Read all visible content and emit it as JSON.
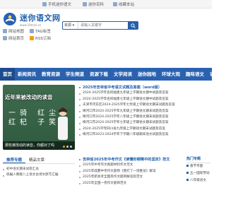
{
  "topbar": {
    "add_to_desktop": "手机迷你语文",
    "bookmark": "设为首页",
    "mobile": "迷你百科",
    "contact": "收藏本站"
  },
  "header": {
    "logo_title": "迷你语文网",
    "logo_sub": "www.19mini.cn",
    "links_row1": [
      "网站地图",
      "TAG标签"
    ],
    "links_row2": [
      "网站首页",
      "RSS订阅"
    ]
  },
  "search": {
    "select_label": "资源",
    "placeholder": "请输入关键字"
  },
  "nav": {
    "items": [
      "首页",
      "新闻资讯",
      "教育资源",
      "学生频道",
      "资源下载",
      "文学阅读",
      "迷你园地",
      "环球大观",
      "趣味语文",
      "语文知"
    ]
  },
  "banner": {
    "title": "近年来被改动的读音",
    "chars_line1": "一骑 红尘",
    "chars_line2": "红杞 子笑",
    "caption": "那些被改动的读音，你都对了吗"
  },
  "news_top": [
    {
      "text": "2025年吉林省中考语文试题及答案（word版）",
      "headline": true
    },
    {
      "text": "2024-2025学年名校福建九年级上学期语文期中试题及答案",
      "headline": false
    },
    {
      "text": "2024-2025学年名校福建七年级上学期语文期中试题及答案",
      "headline": false
    },
    {
      "text": "天津市河东区2024-2025学年七年级上学期语文期末试题及答案",
      "headline": false
    },
    {
      "text": "梅河口市2024-2025学年九年级上学期语文期末试题及答案",
      "headline": false
    },
    {
      "text": "梅河口市2024-2025学年八年级上学期语文期末试题及答案",
      "headline": false
    },
    {
      "text": "梅河口市2024-2025学年七年级上学期语文期末试题及答案",
      "headline": false
    },
    {
      "text": "2024-2025学年四川省九年级上学期语文期末试题及答案",
      "headline": false
    },
    {
      "text": "梅河口市2023-2024学年下学期八年级期末语文试题及答案",
      "headline": false
    }
  ],
  "news_bottom": [
    {
      "text": "吉林省2025年中考作文《读懂你眼睛中的坚定》范文",
      "headline": true
    },
    {
      "text": "2025年中考作文真题材料作文范文",
      "headline": false
    },
    {
      "text": "2025年成都中考作文题目《我打了一场胜仗》解读",
      "headline": false
    },
    {
      "text": "2025年新高考全国卷作文题目解读及范文",
      "headline": false
    },
    {
      "text": "2025年全国一卷作文题目范文",
      "headline": false
    }
  ],
  "bottom_left": {
    "tabs": [
      "推荐专题",
      "精品文章"
    ],
    "items": [
      "初中语文期末试卷汇总",
      "统编人教版八上语文古诗文默写汇编"
    ]
  },
  "sidebar": {
    "heading": "热门专题",
    "items": [
      "春节专题",
      "五一国际劳动",
      "八年级语文"
    ]
  },
  "colors": {
    "brand_blue": "#2a62b0",
    "headline_red": "#e4393c"
  }
}
